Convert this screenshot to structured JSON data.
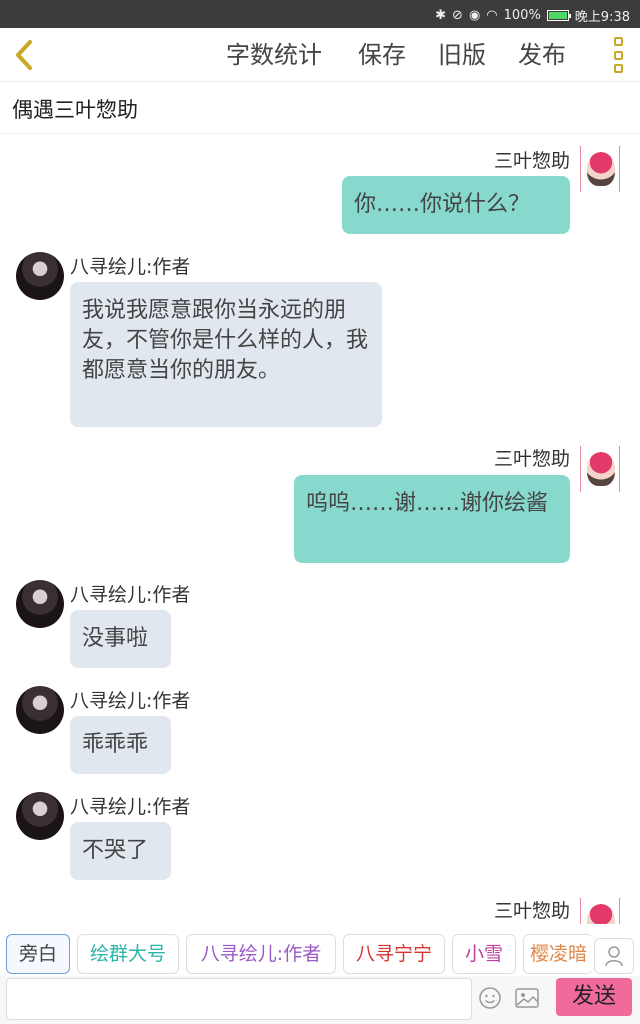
{
  "status_bar": {
    "time": "晚上9:38",
    "battery": "100%",
    "battery_level": 1.0
  },
  "toolbar": {
    "word_count": "字数统计",
    "save": "保存",
    "old_version": "旧版",
    "publish": "发布"
  },
  "title": "偶遇三叶惣助",
  "messages": [
    {
      "side": "right",
      "name": "三叶惣助",
      "text": "你……你说什么？"
    },
    {
      "side": "left",
      "name": "八寻绘儿:作者",
      "text": "我说我愿意跟你当永远的朋友，不管你是什么样的人，我都愿意当你的朋友。"
    },
    {
      "side": "right",
      "name": "三叶惣助",
      "text": "呜呜……谢……谢你绘酱"
    },
    {
      "side": "left",
      "name": "八寻绘儿:作者",
      "text": "没事啦"
    },
    {
      "side": "left",
      "name": "八寻绘儿:作者",
      "text": "乖乖乖"
    },
    {
      "side": "left",
      "name": "八寻绘儿:作者",
      "text": "不哭了"
    },
    {
      "side": "right",
      "name": "三叶惣助",
      "text": ""
    }
  ],
  "chips": [
    {
      "label": "旁白",
      "color": "#444444"
    },
    {
      "label": "绘群大号",
      "color": "#2bb5a8"
    },
    {
      "label": "八寻绘儿:作者",
      "color": "#9b59c9"
    },
    {
      "label": "八寻宁宁",
      "color": "#d9342f"
    },
    {
      "label": "小雪",
      "color": "#c040a0"
    },
    {
      "label": "樱凌暗",
      "color": "#e0884a"
    }
  ],
  "input": {
    "placeholder": "",
    "value": ""
  },
  "send_label": "发送"
}
